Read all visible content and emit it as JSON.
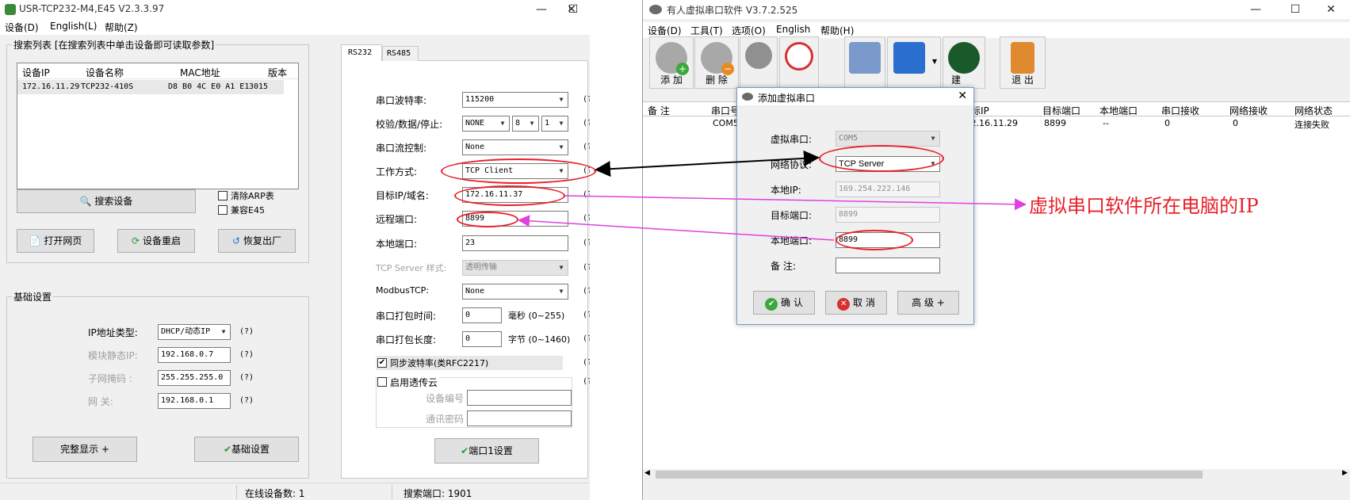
{
  "left": {
    "title": "USR-TCP232-M4,E45 V2.3.3.97",
    "menu": [
      "设备(D)",
      "English(L)",
      "帮助(Z)"
    ],
    "search_group": "搜索列表 [在搜索列表中单击设备即可读取参数]",
    "list_headers": [
      "设备IP",
      "设备名称",
      "MAC地址",
      "版本"
    ],
    "list_row": [
      "172.16.11.29",
      "TCP232-410S",
      "D8 B0 4C E0 A1 E1",
      "3015"
    ],
    "btn_search": "搜索设备",
    "chk_clear_arp": "清除ARP表",
    "chk_compat": "兼容E45",
    "btn_open_web": "打开网页",
    "btn_restart": "设备重启",
    "btn_factory": "恢复出厂",
    "basic_group": "基础设置",
    "ip_type_label": "IP地址类型:",
    "ip_type_value": "DHCP/动态IP",
    "static_ip_label": "模块静态IP:",
    "static_ip": "192.168.0.7",
    "mask_label": "子网掩码 :",
    "mask": "255.255.255.0",
    "gw_label": "网     关:",
    "gw": "192.168.0.1",
    "btn_full": "完整显示  +",
    "btn_basic": "基础设置",
    "tabs": [
      "RS232",
      "RS485"
    ],
    "baud_label": "串口波特率:",
    "baud": "115200",
    "parity_label": "校验/数据/停止:",
    "parity": "NONE",
    "databits": "8",
    "stopbits": "1",
    "flow_label": "串口流控制:",
    "flow": "None",
    "mode_label": "工作方式:",
    "mode": "TCP Client",
    "target_label": "目标IP/域名:",
    "target": "172.16.11.37",
    "remote_port_label": "远程端口:",
    "remote_port": "8899",
    "local_port_label": "本地端口:",
    "local_port": "23",
    "server_mode_label": "TCP Server 样式:",
    "server_mode": "透明传输",
    "modbus_label": "ModbusTCP:",
    "modbus": "None",
    "pack_time_label": "串口打包时间:",
    "pack_time": "0",
    "pack_time_unit": "毫秒 (0~255)",
    "pack_len_label": "串口打包长度:",
    "pack_len": "0",
    "pack_len_unit": "字节 (0~1460)",
    "sync_baud": "同步波特率(类RFC2217)",
    "cloud": "启用透传云",
    "dev_no_label": "设备编号",
    "comm_pwd_label": "通讯密码",
    "btn_port1": "端口1设置",
    "q": "(?)",
    "status_online": "在线设备数: 1",
    "status_port": "搜索端口: 1901"
  },
  "right": {
    "title": "有人虚拟串口软件 V3.7.2.525",
    "menu": [
      "设备(D)",
      "工具(T)",
      "选项(O)",
      "English",
      "帮助(H)"
    ],
    "tools": [
      "添 加",
      "删 除",
      "",
      "",
      "",
      "",
      "",
      "退 出"
    ],
    "tool_partial": "建",
    "list_headers": [
      "备  注",
      "串口号",
      "标IP",
      "目标端口",
      "本地端口",
      "串口接收",
      "网络接收",
      "网络状态"
    ],
    "row": {
      "com": "COM5",
      "ip": ".2.16.11.29",
      "tport": "8899",
      "lport": "--",
      "rx": "0",
      "nrx": "0",
      "state": "连接失败"
    },
    "dialog": {
      "title": "添加虚拟串口",
      "vport_label": "虚拟串口:",
      "vport": "COM5",
      "proto_label": "网络协议:",
      "proto": "TCP Server",
      "lip_label": "本地IP:",
      "lip": "169.254.222.146",
      "tport_label": "目标端口:",
      "tport": "8899",
      "lport_label": "本地端口:",
      "lport": "8899",
      "note_label": "备  注:",
      "ok": "确 认",
      "cancel": "取 消",
      "adv": "高 级  +"
    }
  },
  "annotation": "虚拟串口软件所在电脑的IP",
  "colors": {
    "oval": "#e8202a",
    "magenta": "#e040e0",
    "arrow_black": "#000000"
  }
}
